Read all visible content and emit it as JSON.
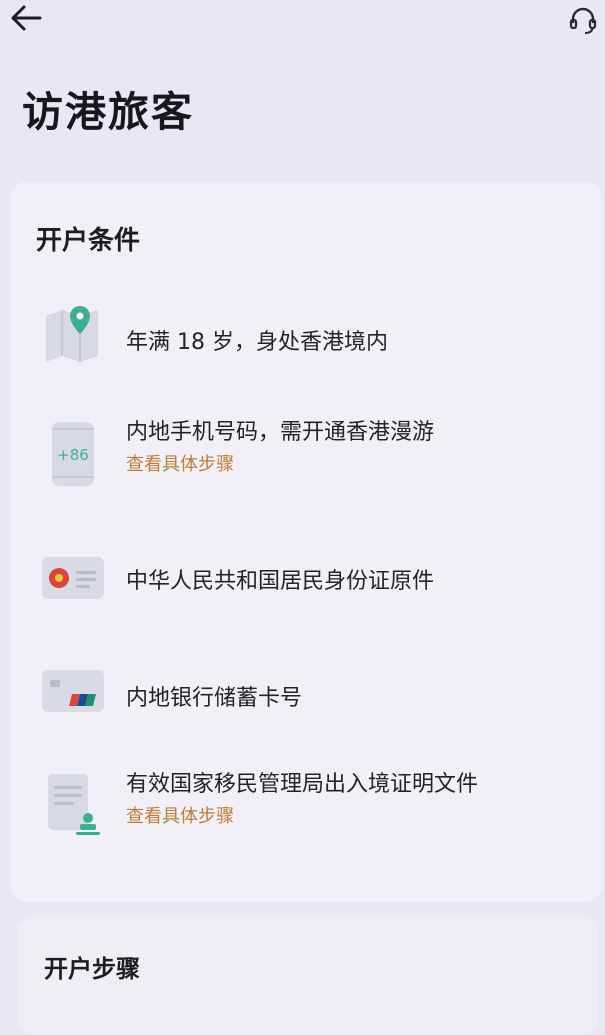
{
  "header": {
    "back_icon": "arrow-left-icon",
    "support_icon": "headset-icon",
    "title": "访港旅客"
  },
  "conditions_card": {
    "title": "开户条件",
    "items": [
      {
        "icon": "map-pin-icon",
        "text": "年满 18 岁，身处香港境内",
        "link": ""
      },
      {
        "icon": "phone-plus86-icon",
        "text": "内地手机号码，需开通香港漫游",
        "link": "查看具体步骤",
        "icon_label": "+86"
      },
      {
        "icon": "id-card-icon",
        "text": "中华人民共和国居民身份证原件",
        "link": ""
      },
      {
        "icon": "bank-card-icon",
        "text": "内地银行储蓄卡号",
        "link": ""
      },
      {
        "icon": "document-stamp-icon",
        "text": "有效国家移民管理局出入境证明文件",
        "link": "查看具体步骤"
      }
    ]
  },
  "steps_card": {
    "title": "开户步骤"
  },
  "colors": {
    "background": "#e9e8f2",
    "card": "#f1f0f6",
    "link": "#c07a3a",
    "accent_green": "#3fae8e",
    "emblem_red": "#d8463f"
  }
}
